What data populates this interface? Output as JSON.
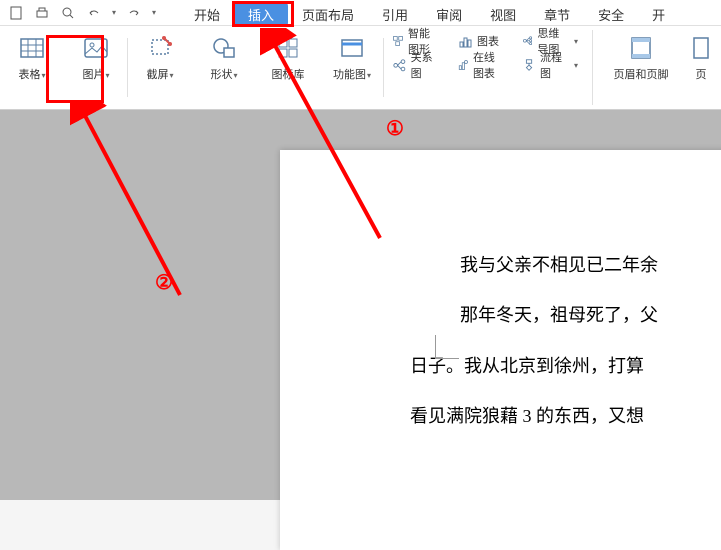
{
  "quickAccess": {
    "icons": [
      "new-doc",
      "print",
      "preview",
      "undo",
      "redo"
    ]
  },
  "tabs": {
    "items": [
      {
        "label": "开始",
        "active": false
      },
      {
        "label": "插入",
        "active": true
      },
      {
        "label": "页面布局",
        "active": false
      },
      {
        "label": "引用",
        "active": false
      },
      {
        "label": "审阅",
        "active": false
      },
      {
        "label": "视图",
        "active": false
      },
      {
        "label": "章节",
        "active": false
      },
      {
        "label": "安全",
        "active": false
      },
      {
        "label": "开",
        "active": false
      }
    ]
  },
  "ribbon": {
    "bigButtons": [
      {
        "label": "表格",
        "icon": "table",
        "dropdown": true
      },
      {
        "label": "图片",
        "icon": "picture",
        "dropdown": true
      },
      {
        "label": "截屏",
        "icon": "screenshot",
        "dropdown": true
      },
      {
        "label": "形状",
        "icon": "shapes",
        "dropdown": true
      },
      {
        "label": "图标库",
        "icon": "icon-lib",
        "dropdown": false
      },
      {
        "label": "功能图",
        "icon": "func-chart",
        "dropdown": true
      }
    ],
    "smallButtons": {
      "col1": [
        {
          "label": "智能图形",
          "icon": "smart-art"
        },
        {
          "label": "关系图",
          "icon": "relation"
        }
      ],
      "col2": [
        {
          "label": "图表",
          "icon": "chart"
        },
        {
          "label": "在线图表",
          "icon": "online-chart"
        }
      ],
      "col3": [
        {
          "label": "思维导图",
          "icon": "mindmap",
          "dropdown": true
        },
        {
          "label": "流程图",
          "icon": "flowchart",
          "dropdown": true
        }
      ]
    },
    "rightBig": [
      {
        "label": "页眉和页脚",
        "icon": "header-footer"
      },
      {
        "label": "页",
        "icon": "page"
      }
    ]
  },
  "document": {
    "lines": [
      "我与父亲不相见已二年余",
      "那年冬天，祖母死了，父",
      "日子。我从北京到徐州，打算",
      "看见满院狼藉 3 的东西，又想"
    ]
  },
  "annotations": {
    "num1": "①",
    "num2": "②"
  }
}
